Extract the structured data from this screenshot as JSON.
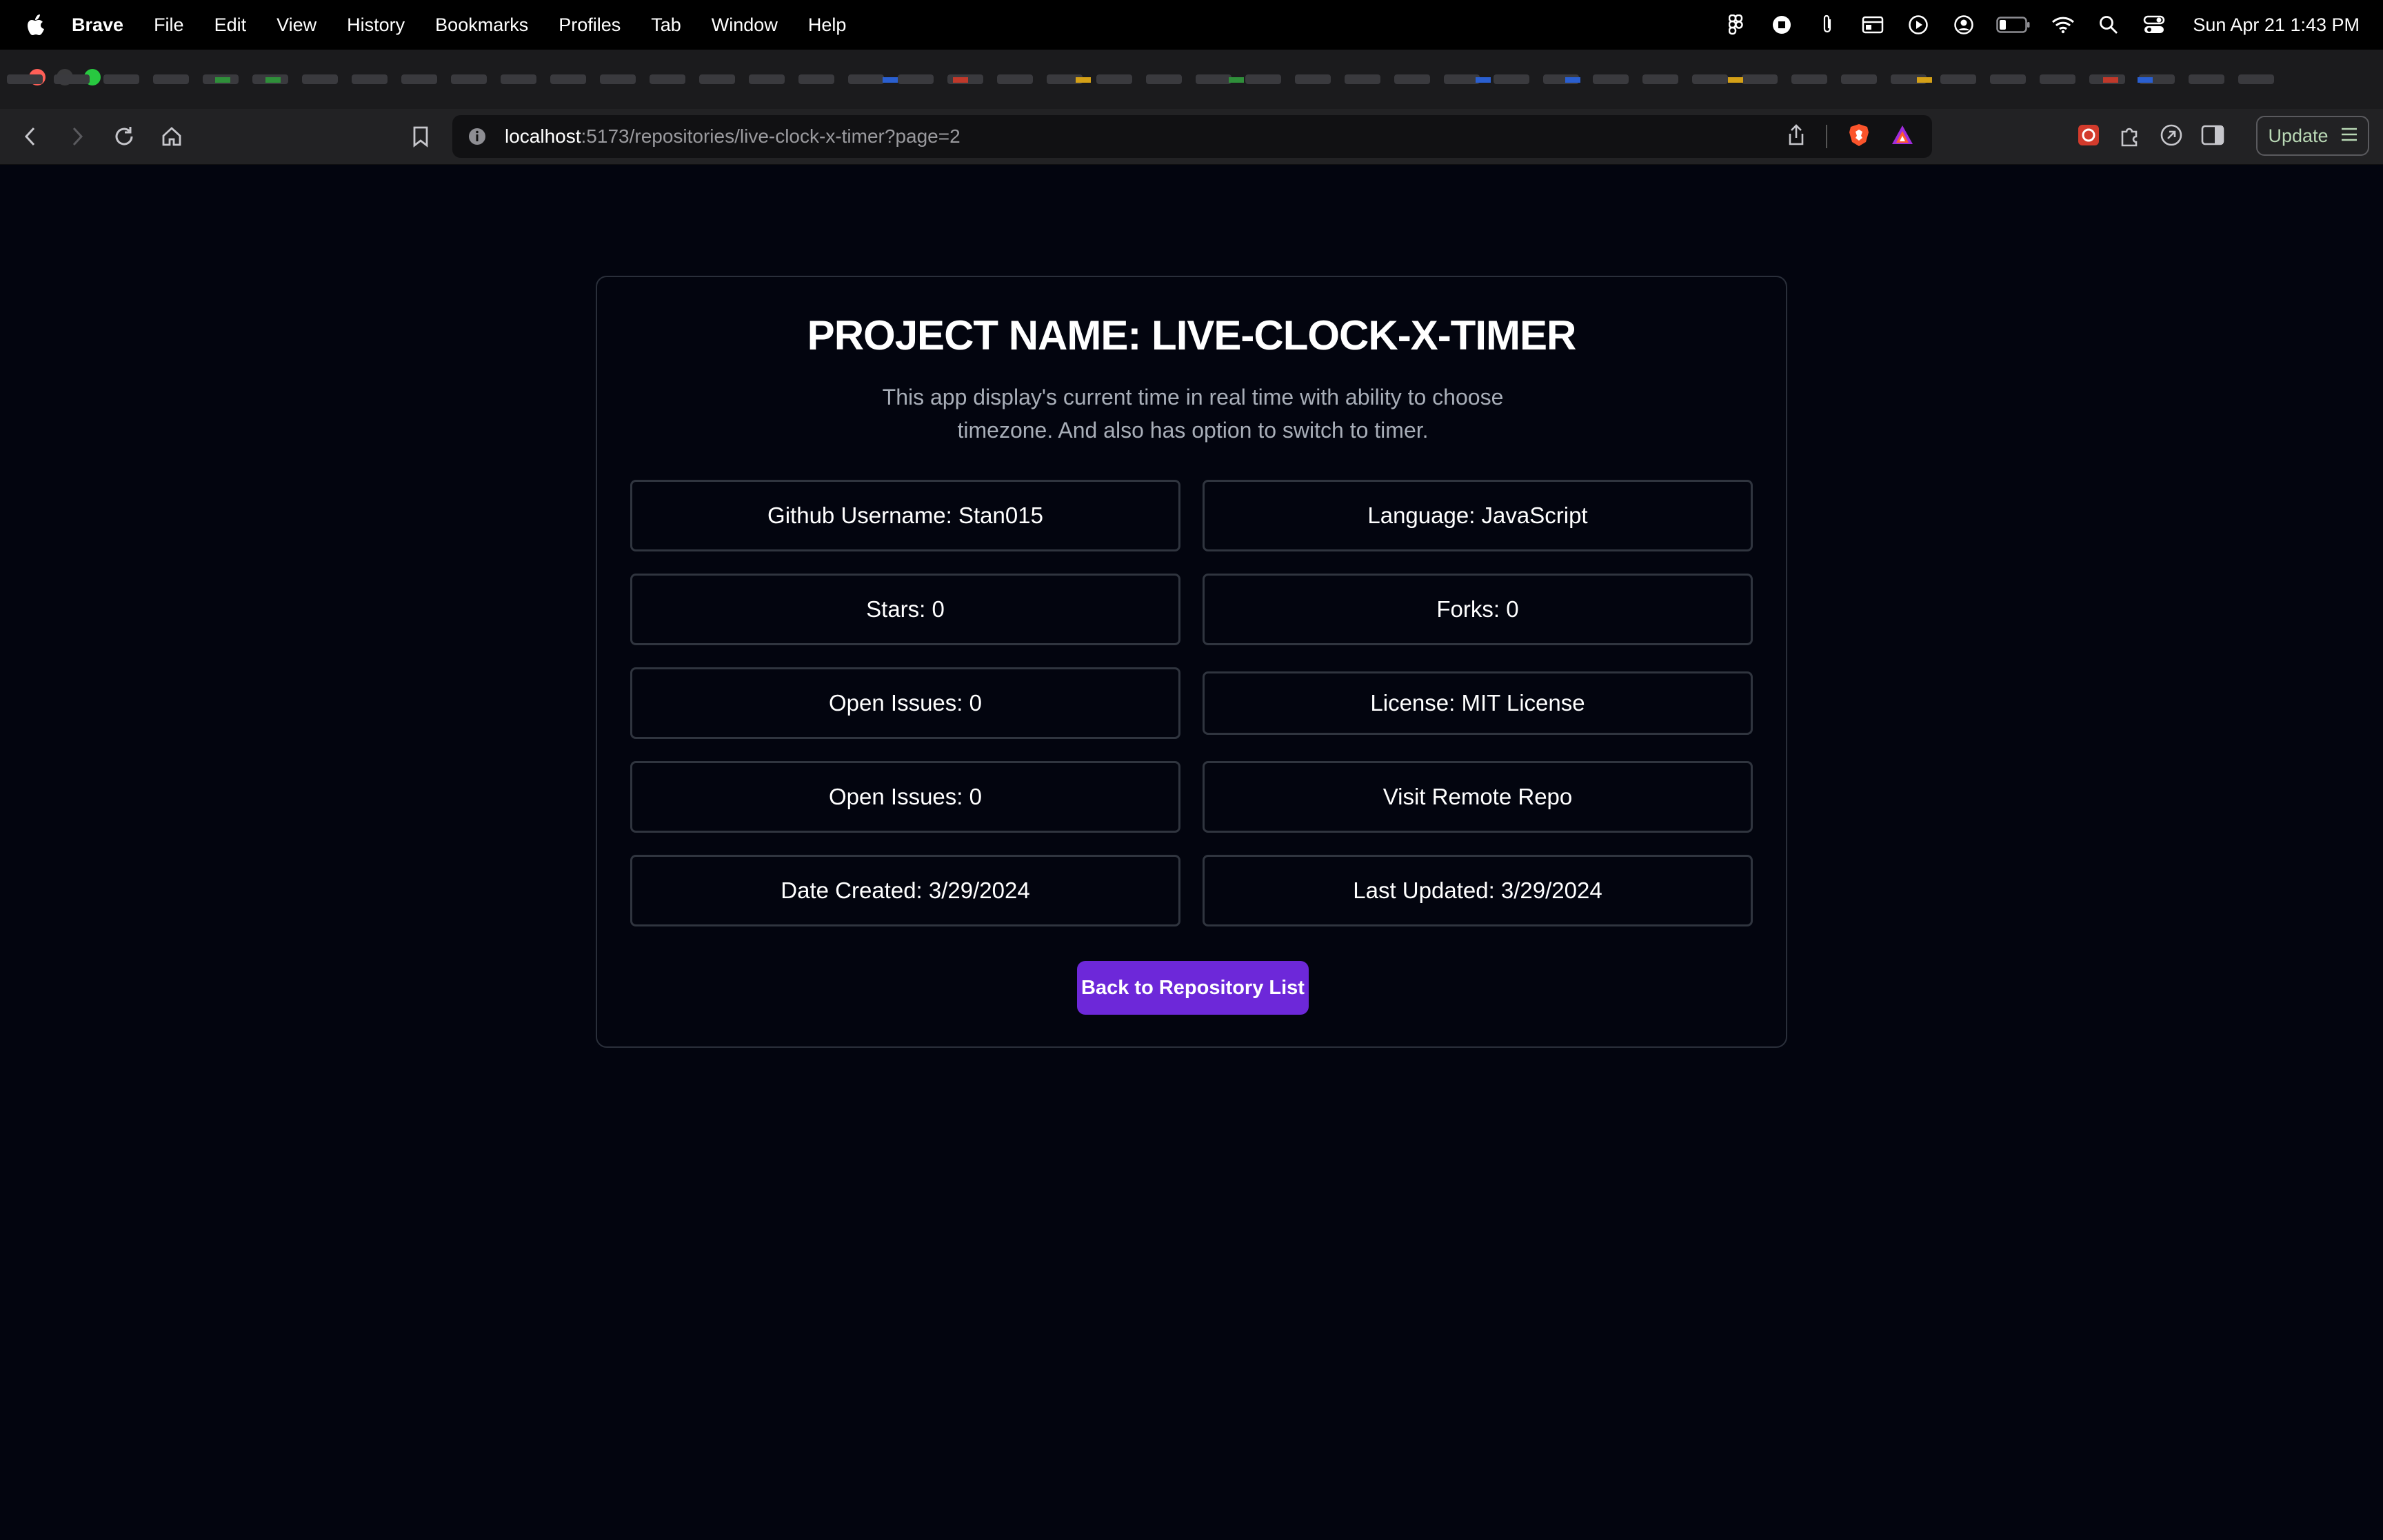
{
  "menubar": {
    "app_name": "Brave",
    "items": [
      "File",
      "Edit",
      "View",
      "History",
      "Bookmarks",
      "Profiles",
      "Tab",
      "Window",
      "Help"
    ],
    "clock": "Sun Apr 21  1:43 PM"
  },
  "toolbar": {
    "url_host": "localhost",
    "url_path": ":5173/repositories/live-clock-x-timer?page=2",
    "update_label": "Update"
  },
  "repo": {
    "title": "PROJECT NAME: LIVE-CLOCK-X-TIMER",
    "description": "This app display's current time in real time with ability to choose timezone. And also has option to switch to timer.",
    "github_username": "Github Username: Stan015",
    "language": "Language: JavaScript",
    "stars": "Stars: 0",
    "forks": "Forks: 0",
    "open_issues": "Open Issues: 0",
    "license": "License: MIT License",
    "open_issues_2": "Open Issues: 0",
    "visit_remote": "Visit Remote Repo",
    "date_created": "Date Created: 3/29/2024",
    "last_updated": "Last Updated: 3/29/2024",
    "back_button": "Back to Repository List"
  },
  "colors": {
    "background": "#03050f",
    "accent": "#6d28d9",
    "box_border": "#30353f"
  }
}
